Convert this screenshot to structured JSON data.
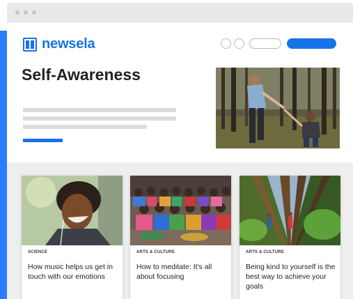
{
  "brand": {
    "name": "newsela",
    "color": "#1673ea"
  },
  "page": {
    "title": "Self-Awareness"
  },
  "hero": {
    "image": "forest-hike-helping-hand-photo"
  },
  "cards": [
    {
      "category": "SCIENCE",
      "headline": "How music helps us get in touch with our emotions",
      "image": "smiling-person-earbuds-photo"
    },
    {
      "category": "ARTS & CULTURE",
      "headline": "How to meditate: It's all about focusing",
      "image": "children-meditating-photo"
    },
    {
      "category": "ARTS & CULTURE",
      "headline": "Being kind to yourself is the best way to achieve your goals",
      "image": "tall-trees-hikers-photo"
    }
  ],
  "colors": {
    "accent": "#2b7bff",
    "band": "#eeeeee"
  }
}
